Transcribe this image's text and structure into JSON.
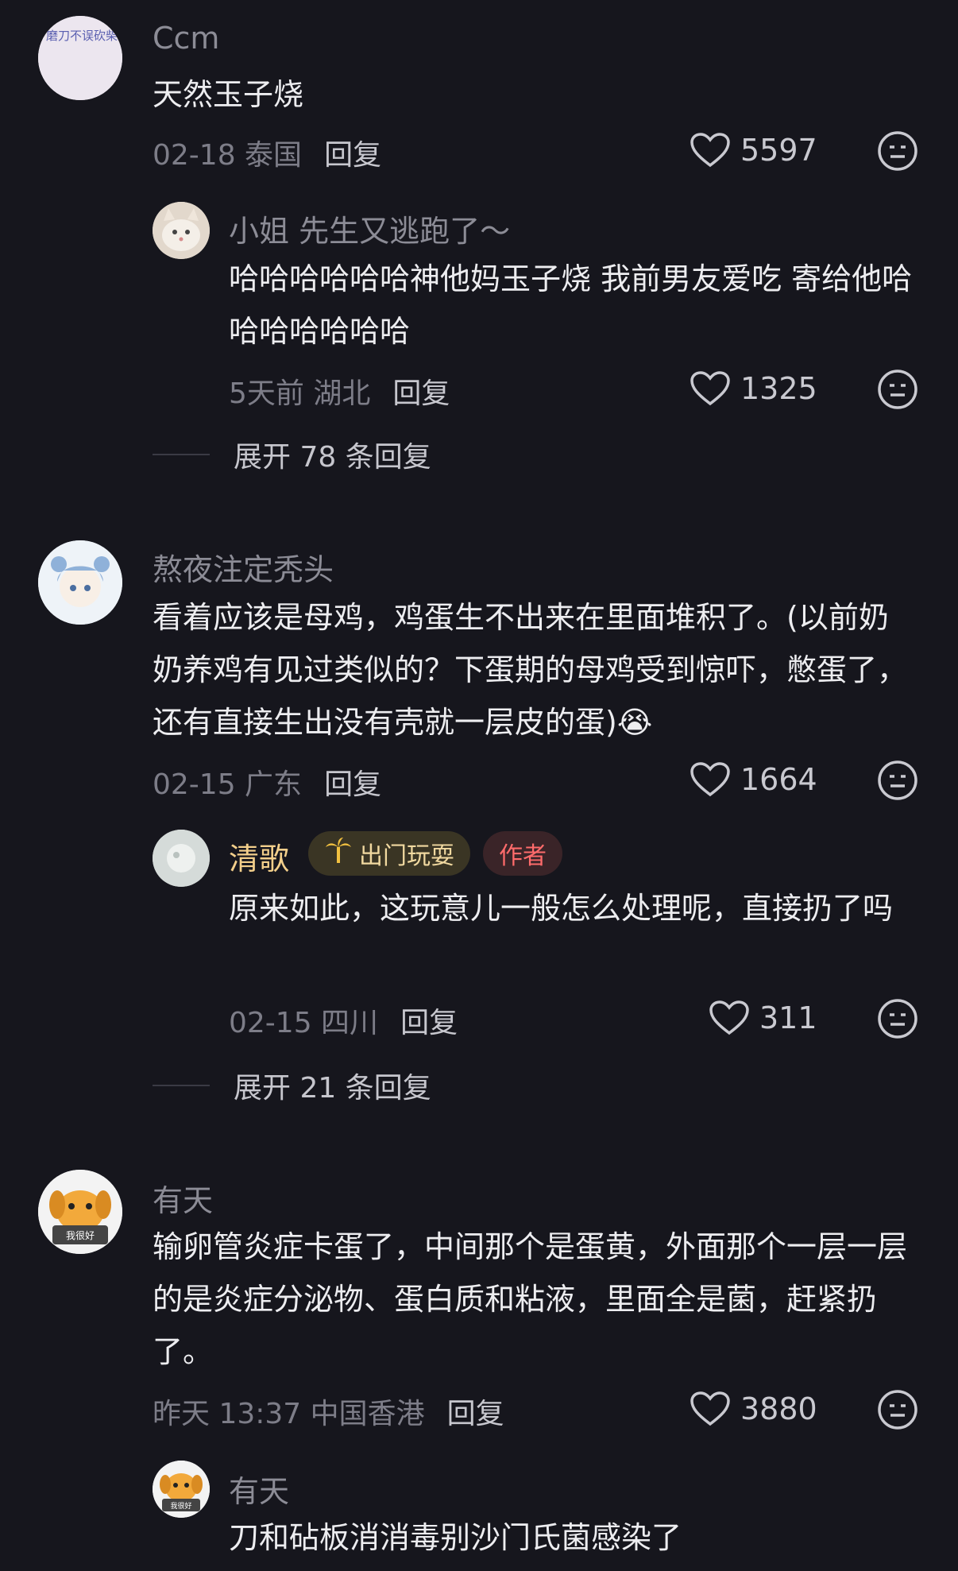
{
  "comments": [
    {
      "name": "Ccm",
      "text": "天然玉子烧",
      "date_loc": "02-18 泰国",
      "reply": "回复",
      "likes": "5597",
      "avatar_text": "磨刀不误砍柴工，读完初中再打工"
    },
    {
      "name": "小姐 先生又逃跑了～",
      "text": "哈哈哈哈哈哈神他妈玉子烧 我前男友爱吃 寄给他哈哈哈哈哈哈哈",
      "date_loc": "5天前 湖北",
      "reply": "回复",
      "likes": "1325",
      "expand": "展开 78 条回复"
    },
    {
      "name": "熬夜注定秃头",
      "text": "看着应该是母鸡，鸡蛋生不出来在里面堆积了。(以前奶奶养鸡有见过类似的？下蛋期的母鸡受到惊吓，憋蛋了，还有直接生出没有壳就一层皮的蛋)",
      "emoji": "😭",
      "date_loc": "02-15 广东",
      "reply": "回复",
      "likes": "1664"
    },
    {
      "name": "清歌",
      "badge_trip": "出门玩耍",
      "badge_author": "作者",
      "text": "原来如此，这玩意儿一般怎么处理呢，直接扔了吗",
      "date_loc": "02-15 四川",
      "reply": "回复",
      "likes": "311",
      "expand": "展开 21 条回复"
    },
    {
      "name": "有天",
      "text": "输卵管炎症卡蛋了，中间那个是蛋黄，外面那个一层一层的是炎症分泌物、蛋白质和粘液，里面全是菌，赶紧扔了。",
      "date_loc": "昨天 13:37 中国香港",
      "reply": "回复",
      "likes": "3880",
      "avatar_text": "我很好"
    },
    {
      "name": "有天",
      "text": "刀和砧板消消毒别沙门氏菌感染了",
      "avatar_text": "我很好"
    }
  ],
  "colors": {
    "background": "#16161d",
    "text": "#ededf0",
    "muted": "#8c8c96",
    "author_badge": "#ff6b6b"
  },
  "icons": [
    "heart-icon",
    "dislike-face-icon",
    "palm-tree-icon"
  ]
}
